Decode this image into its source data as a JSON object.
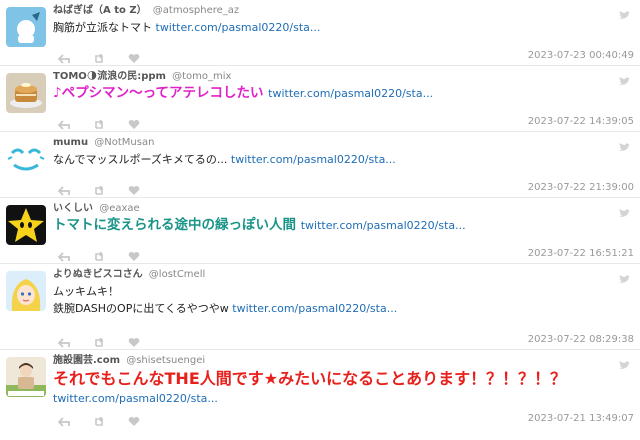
{
  "tweets": [
    {
      "name": "ねばぎば（A to Z）",
      "handle": "@atmosphere_az",
      "text": "胸筋が立派なトマト",
      "link": "twitter.com/pasmal0220/sta...",
      "time": "2023-07-23 00:40:49"
    },
    {
      "name": "TOMO🌗流浪の民:ppm",
      "handle": "@tomo_mix",
      "text": "♪ペプシマン～ってアテレコしたい",
      "link": "twitter.com/pasmal0220/sta...",
      "time": "2023-07-22 14:39:05",
      "text_color": "#e020c8"
    },
    {
      "name": "mumu",
      "handle": "@NotMusan",
      "text": "なんでマッスルポーズキメてるの...",
      "link": "twitter.com/pasmal0220/sta...",
      "time": "2023-07-22 21:39:00"
    },
    {
      "name": "いくしい",
      "handle": "@eaxae",
      "text": "トマトに変えられる途中の緑っぽい人間",
      "link": "twitter.com/pasmal0220/sta...",
      "time": "2023-07-22 16:51:21",
      "text_color": "#1a9488"
    },
    {
      "name": "よりぬきビスコさん",
      "handle": "@lostCmell",
      "text_line1": "ムッキムキ！",
      "text": "鉄腕DASHのOPに出てくるやつやw",
      "link": "twitter.com/pasmal0220/sta...",
      "time": "2023-07-22 08:29:38"
    },
    {
      "name": "施設園芸.com",
      "handle": "@shisetsuengei",
      "text": "それでもこんなTHE人間です★みたいになることあります！？！？！？",
      "link": "twitter.com/pasmal0220/sta...",
      "time": "2023-07-21 13:49:07",
      "text_color": "#e8201c"
    }
  ],
  "icons": {
    "reply": "reply-icon",
    "retweet": "retweet-icon",
    "like": "heart-icon",
    "bird": "twitter-bird-icon"
  }
}
